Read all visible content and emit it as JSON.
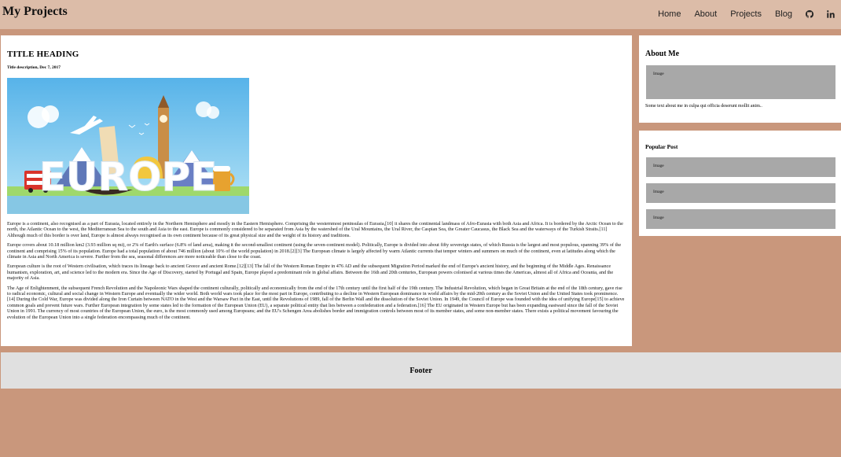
{
  "header": {
    "brand": "My Projects",
    "nav": [
      "Home",
      "About",
      "Projects",
      "Blog"
    ]
  },
  "article": {
    "title": "TITLE HEADING",
    "description": "Title description, Dec 7, 2017",
    "image_text": "EUROPE",
    "paragraphs": [
      "Europe is a continent, also recognised as a part of Eurasia, located entirely in the Northern Hemisphere and mostly in the Eastern Hemisphere. Comprising the westernmost peninsulas of Eurasia,[10] it shares the continental landmass of Afro-Eurasia with both Asia and Africa. It is bordered by the Arctic Ocean to the north, the Atlantic Ocean to the west, the Mediterranean Sea to the south and Asia to the east. Europe is commonly considered to be separated from Asia by the watershed of the Ural Mountains, the Ural River, the Caspian Sea, the Greater Caucasus, the Black Sea and the waterways of the Turkish Straits.[11] Although much of this border is over land, Europe is almost always recognised as its own continent because of its great physical size and the weight of its history and traditions.",
      "Europe covers about 10.18 million km2 (3.93 million sq mi), or 2% of Earth's surface (6.8% of land area), making it the second-smallest continent (using the seven-continent model). Politically, Europe is divided into about fifty sovereign states, of which Russia is the largest and most populous, spanning 39% of the continent and comprising 15% of its population. Europe had a total population of about 746 million (about 10% of the world population) in 2018.[2][3] The European climate is largely affected by warm Atlantic currents that temper winters and summers on much of the continent, even at latitudes along which the climate in Asia and North America is severe. Further from the sea, seasonal differences are more noticeable than close to the coast.",
      "European culture is the root of Western civilisation, which traces its lineage back to ancient Greece and ancient Rome.[12][13] The fall of the Western Roman Empire in 476 AD and the subsequent Migration Period marked the end of Europe's ancient history, and the beginning of the Middle Ages. Renaissance humanism, exploration, art, and science led to the modern era. Since the Age of Discovery, started by Portugal and Spain, Europe played a predominant role in global affairs. Between the 16th and 20th centuries, European powers colonised at various times the Americas, almost all of Africa and Oceania, and the majority of Asia.",
      "The Age of Enlightenment, the subsequent French Revolution and the Napoleonic Wars shaped the continent culturally, politically and economically from the end of the 17th century until the first half of the 19th century. The Industrial Revolution, which began in Great Britain at the end of the 18th century, gave rise to radical economic, cultural and social change in Western Europe and eventually the wider world. Both world wars took place for the most part in Europe, contributing to a decline in Western European dominance in world affairs by the mid-20th century as the Soviet Union and the United States took prominence.[14] During the Cold War, Europe was divided along the Iron Curtain between NATO in the West and the Warsaw Pact in the East, until the Revolutions of 1989, fall of the Berlin Wall and the dissolution of the Soviet Union. In 1949, the Council of Europe was founded with the idea of unifying Europe[15] to achieve common goals and prevent future wars. Further European integration by some states led to the formation of the European Union (EU), a separate political entity that lies between a confederation and a federation.[16] The EU originated in Western Europe but has been expanding eastward since the fall of the Soviet Union in 1991. The currency of most countries of the European Union, the euro, is the most commonly used among Europeans; and the EU's Schengen Area abolishes border and immigration controls between most of its member states, and some non-member states. There exists a political movement favouring the evolution of the European Union into a single federation encompassing much of the continent."
    ]
  },
  "about": {
    "heading": "About Me",
    "image_label": "Image",
    "text": "Some text about me in culpa qui officia deserunt mollit anim.."
  },
  "popular": {
    "heading": "Popular Post",
    "items": [
      "Image",
      "Image",
      "Image"
    ]
  },
  "footer": {
    "text": "Footer"
  },
  "icons": [
    "github-icon",
    "linkedin-icon"
  ]
}
